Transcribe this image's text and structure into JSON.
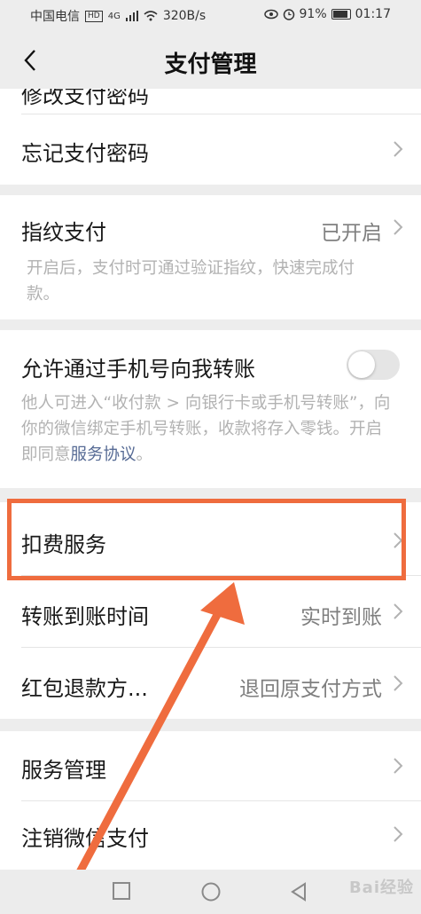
{
  "status_bar": {
    "carrier": "中国电信",
    "hd": "HD",
    "net": "4G",
    "speed": "320B/s",
    "battery": "91%",
    "time": "01:17"
  },
  "header": {
    "title": "支付管理"
  },
  "rows": {
    "modify_password": "修改支付密码",
    "forgot_password": "忘记支付密码",
    "fingerprint": {
      "label": "指纹支付",
      "value": "已开启",
      "desc": "开启后，支付时可通过验证指纹，快速完成付款。"
    },
    "phone_transfer": {
      "label": "允许通过手机号向我转账",
      "enabled": false,
      "desc": "他人可进入“收付款 > 向银行卡或手机号转账”，向你的微信绑定手机号转账，收款将存入零钱。开启即同意",
      "desc_link": "服务协议",
      "desc_end": "。"
    },
    "deduction_services": "扣费服务",
    "transfer_time": {
      "label": "转账到账时间",
      "value": "实时到账"
    },
    "red_packet_refund": {
      "label": "红包退款方...",
      "value": "退回原支付方式"
    },
    "service_management": "服务管理",
    "cancel_wechat_pay": "注销微信支付"
  },
  "watermark": "Bai经验",
  "colors": {
    "highlight": "#ef6c3e",
    "link": "#576b95"
  }
}
